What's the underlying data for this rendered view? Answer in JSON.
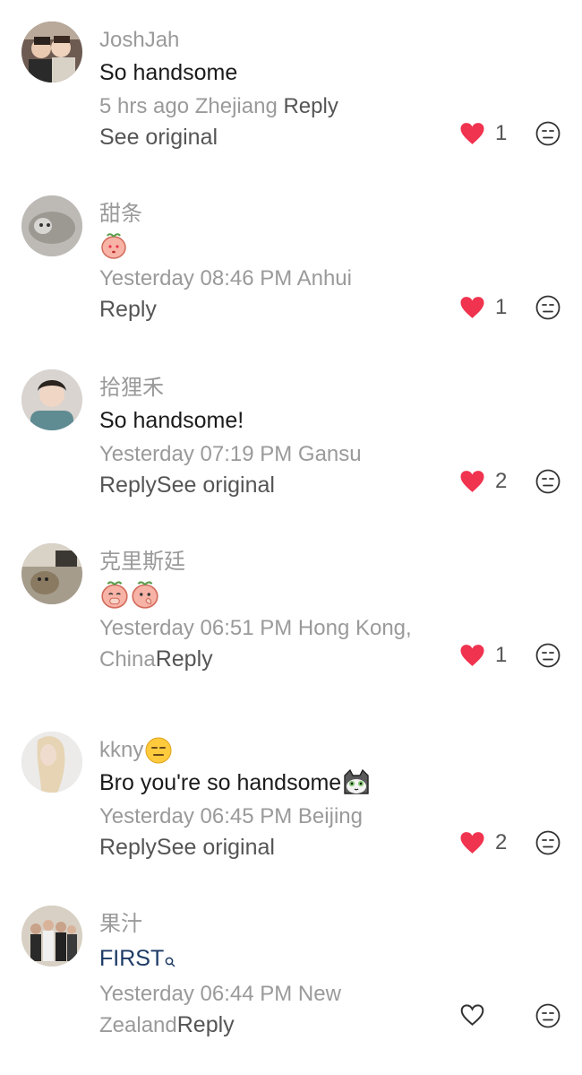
{
  "comments": [
    {
      "username": "JoshJah",
      "text": "So handsome",
      "time_location": "5 hrs ago Zhejiang",
      "reply_label": "Reply",
      "see_original": "See original",
      "likes": "1",
      "liked": true
    },
    {
      "username": "甜条",
      "text": "",
      "time_location": "Yesterday 08:46 PM Anhui",
      "reply_label": "Reply",
      "likes": "1",
      "liked": true
    },
    {
      "username": "拾狸禾",
      "text": "So handsome!",
      "time_location": "Yesterday 07:19 PM Gansu",
      "reply_label": "Reply",
      "see_original": "See original",
      "likes": "2",
      "liked": true
    },
    {
      "username": "克里斯廷",
      "text": "",
      "time_location": "Yesterday 06:51 PM Hong Kong,",
      "time_location_cont": "China",
      "reply_label": "Reply",
      "likes": "1",
      "liked": true
    },
    {
      "username": "kkny",
      "text": "Bro you're so handsome",
      "time_location": "Yesterday 06:45 PM Beijing",
      "reply_label": "Reply",
      "see_original": "See original",
      "likes": "2",
      "liked": true
    },
    {
      "username": "果汁",
      "text": "FIRST",
      "time_location": "Yesterday 06:44 PM New",
      "time_location_cont": "Zealand",
      "reply_label": "Reply",
      "likes": "",
      "liked": false
    }
  ],
  "colors": {
    "heart": "#f0334f",
    "meta": "#9a9a9a",
    "link": "#1d3a66"
  },
  "icons": {
    "like": "heart-icon",
    "dislike": "meh-face-icon",
    "search_hint": "search-icon"
  }
}
